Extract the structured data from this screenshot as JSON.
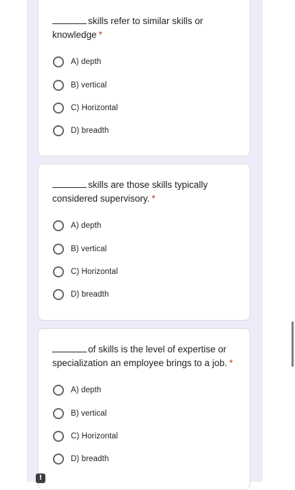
{
  "questions": [
    {
      "text": "skills refer to similar skills or knowledge",
      "required_mark": "*",
      "options": [
        "A) depth",
        "B) vertical",
        "C) Horizontal",
        "D) breadth"
      ]
    },
    {
      "text": "skills are those skills typically considered supervisory.",
      "required_mark": "*",
      "options": [
        "A) depth",
        "B) vertical",
        "C) Horizontal",
        "D) breadth"
      ]
    },
    {
      "text": "of skills is the level of expertise or specialization an employee brings to a job.",
      "required_mark": "*",
      "options": [
        "A) depth",
        "B) vertical",
        "C) Horizontal",
        "D) breadth"
      ]
    }
  ],
  "corner_badge": "!",
  "icons": {
    "radio": "radio-unchecked-icon",
    "corner": "alert-icon"
  },
  "colors": {
    "page_background": "#f0ebf8",
    "required": "#d93025",
    "radio_border": "#5f6368"
  }
}
